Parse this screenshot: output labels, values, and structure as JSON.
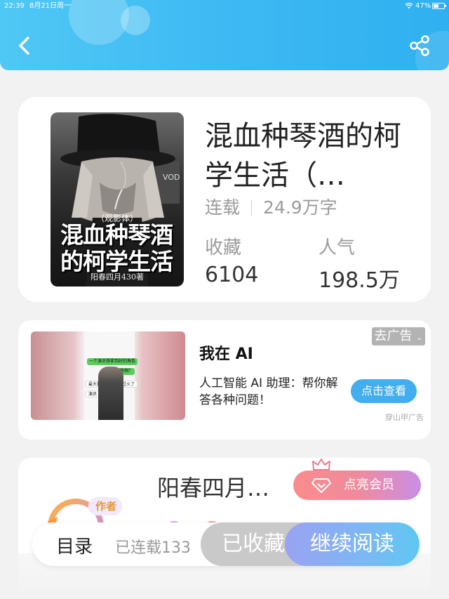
{
  "status_bar": {
    "time": "22:39",
    "date": "8月21日周一",
    "battery": "47%",
    "battery_level": 0.47,
    "wifi_icon": "wifi-icon",
    "battery_icon": "battery-icon"
  },
  "header": {
    "back_icon": "back-arrow-icon",
    "share_icon": "share-icon",
    "color": "#3eb9f3"
  },
  "book": {
    "title": "混血种琴酒的柯学生活（…",
    "status": "连载",
    "word_count": "24.9万字",
    "favorites_label": "收藏",
    "favorites_value": "6104",
    "popularity_label": "人气",
    "popularity_value": "198.5万",
    "cover": {
      "subtitle": "（观影体）",
      "title": "混血种琴酒的柯学生活",
      "author": "阳春四月430著"
    }
  },
  "ad": {
    "remove_label": "去广告",
    "title": "我在 AI",
    "description": "人工智能 AI 助理：帮你解答各种问题！",
    "cta": "点击查看",
    "source": "穿山甲广告",
    "image_bubbles": [
      "一个演员想拿到好的角色",
      "怎么回答啊？",
      "最大投其所好你说过火了",
      "演员"
    ]
  },
  "author": {
    "badge": "作者",
    "name": "阳春四月…",
    "vip_label": "点亮会员",
    "crown_icon": "crown-icon",
    "diamond_icon": "diamond-icon"
  },
  "bottom_bar": {
    "toc_label": "目录",
    "chapter_count": "已连载133",
    "collected_label": "已收藏",
    "read_label": "继续阅读"
  }
}
